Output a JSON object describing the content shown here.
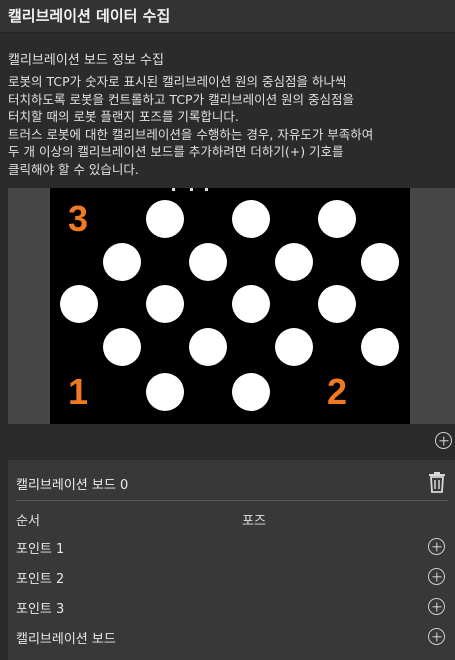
{
  "header": {
    "title": "캘리브레이션 데이터 수집"
  },
  "section": {
    "title": "캘리브레이션 보드 정보 수집",
    "description_lines": [
      "로봇의 TCP가 숫자로 표시된 캘리브레이션 원의 중심점을 하나씩",
      "터치하도록 로봇을 컨트롤하고 TCP가 캘리브레이션 원의 중심점을",
      "터치할 때의 로봇 플랜지 포즈를 기록합니다.",
      "트러스 로봇에 대한 캘리브레이션을 수행하는 경우, 자유도가 부족하여",
      "두 개 이상의 캘리브레이션 보드를 추가하려면 더하기(+) 기호를",
      "클릭해야 할 수 있습니다."
    ]
  },
  "board_image": {
    "markers": [
      "3",
      "1",
      "2"
    ],
    "marker_color": "#f07a22",
    "background_color": "#000000",
    "circle_color": "#ffffff"
  },
  "icons": {
    "add_board": "plus-circle-icon",
    "delete_board": "trash-icon",
    "add_pose": "plus-circle-icon"
  },
  "board": {
    "name": "캘리브레이션 보드 0",
    "columns": {
      "order": "순서",
      "pose": "포즈"
    },
    "rows": [
      {
        "label": "포인트 1"
      },
      {
        "label": "포인트 2"
      },
      {
        "label": "포인트 3"
      },
      {
        "label": "캘리브레이션 보드"
      }
    ]
  }
}
